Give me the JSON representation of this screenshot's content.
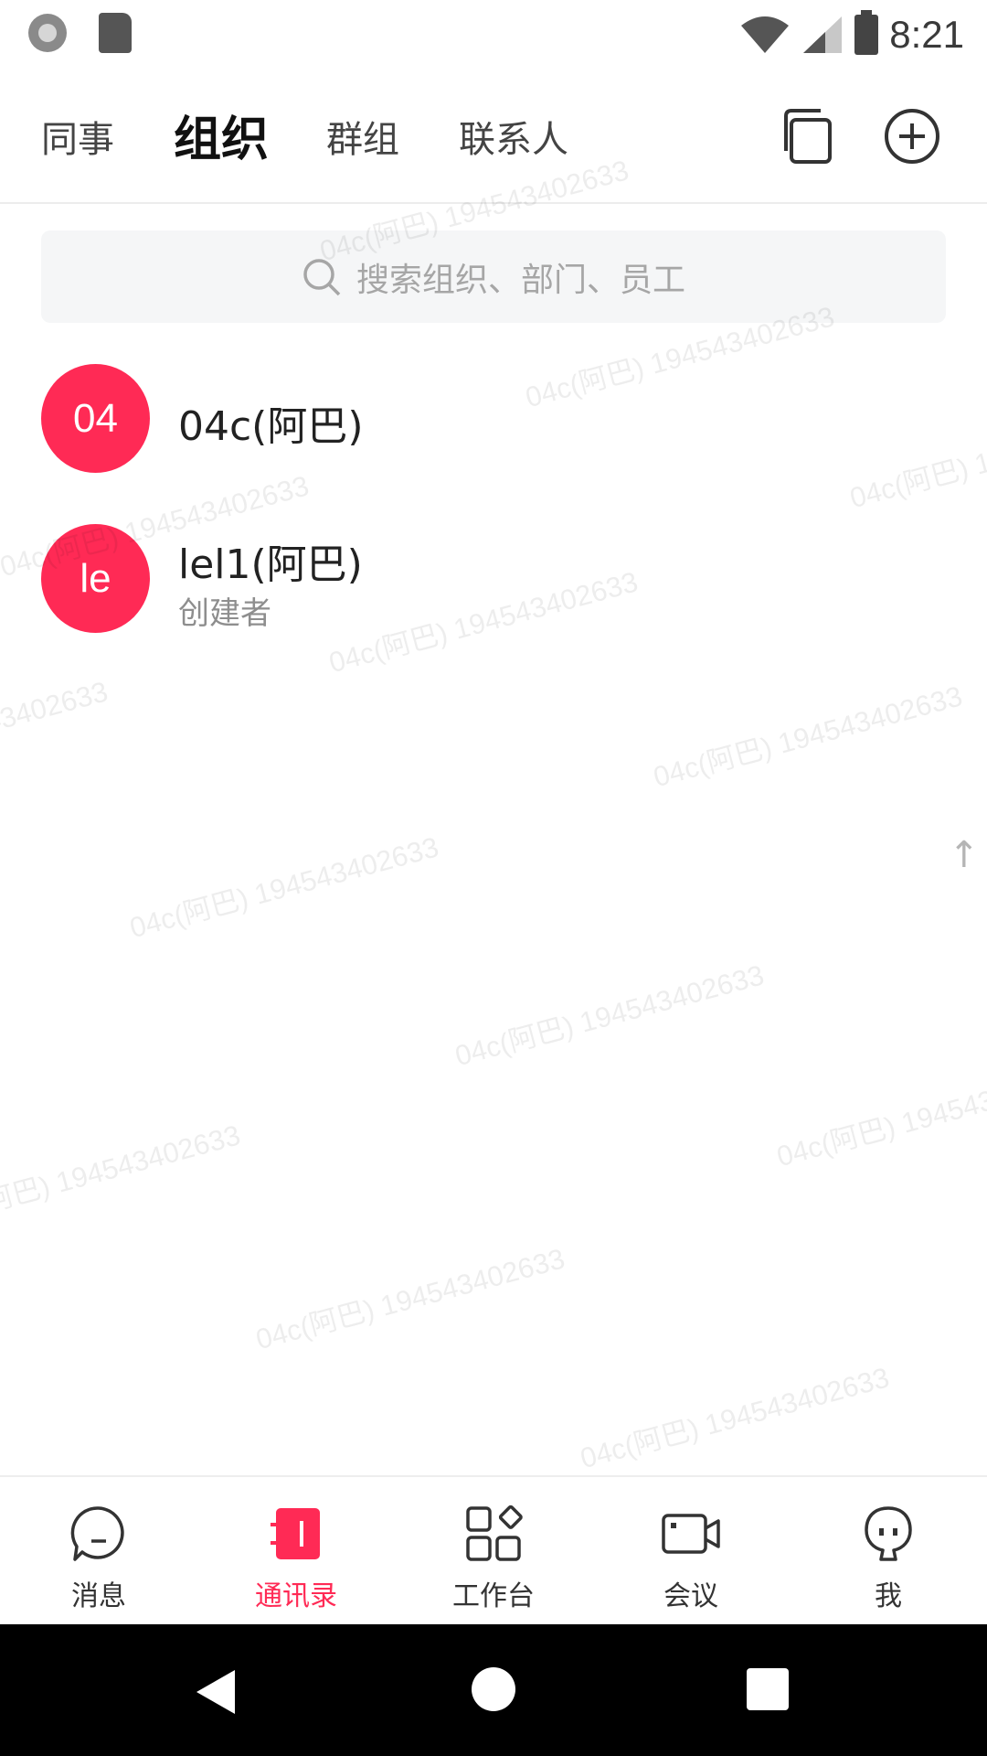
{
  "status_bar": {
    "time": "8:21"
  },
  "header": {
    "tabs": [
      {
        "label": "同事"
      },
      {
        "label": "组织"
      },
      {
        "label": "群组"
      },
      {
        "label": "联系人"
      }
    ]
  },
  "search": {
    "placeholder": "搜索组织、部门、员工"
  },
  "list": [
    {
      "avatar": "04",
      "name": "04c(阿巴)"
    },
    {
      "avatar": "le",
      "name": "lel1(阿巴)",
      "role": "创建者"
    }
  ],
  "scroll_top_glyph": "↑",
  "watermark": "04c(阿巴) 194543402633",
  "bottom_nav": [
    {
      "label": "消息"
    },
    {
      "label": "通讯录"
    },
    {
      "label": "工作台"
    },
    {
      "label": "会议"
    },
    {
      "label": "我"
    }
  ],
  "colors": {
    "accent": "#ff2a55",
    "text": "#222222",
    "muted": "#8e8e8e",
    "search_bg": "#f5f6f7"
  }
}
